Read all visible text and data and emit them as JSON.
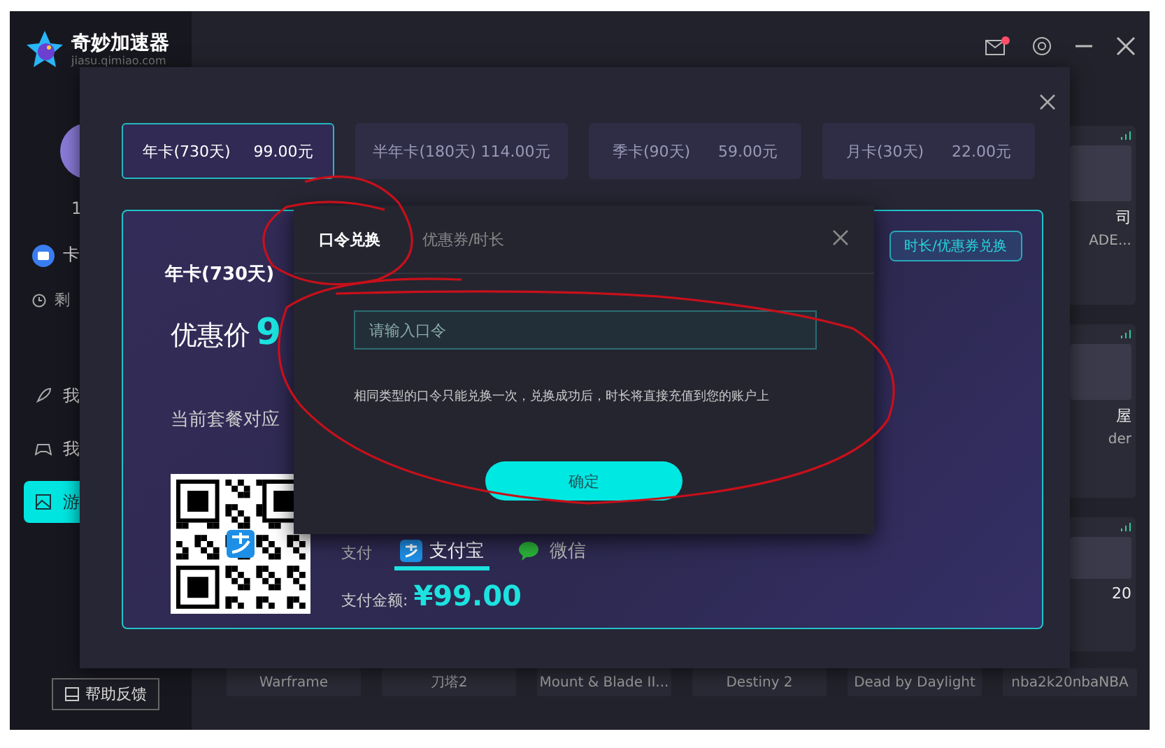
{
  "app": {
    "name": "奇妙加速器",
    "domain": "jiasu.qimiao.com"
  },
  "sidebar": {
    "user_fragment": "1",
    "card_label": "卡",
    "remaining_label": "剩",
    "items": [
      {
        "kind": "rocket",
        "label": "我",
        "selected": false
      },
      {
        "kind": "gamepad",
        "label": "我",
        "selected": false
      },
      {
        "kind": "picture",
        "label": "游",
        "selected": true
      }
    ],
    "help_button": "帮助反馈"
  },
  "games": {
    "cards": [
      {
        "title": "司",
        "subtitle": "ADE..."
      },
      {
        "title": "屋",
        "subtitle": "der"
      },
      {
        "title": "20"
      }
    ],
    "captions": [
      "Warframe",
      "刀塔2",
      "Mount & Blade II...",
      "Destiny 2",
      "Dead by Daylight",
      "nba2k20nbaNBA"
    ]
  },
  "purchase": {
    "plans": [
      {
        "name": "年卡(730天)",
        "price": "99.00元",
        "selected": true
      },
      {
        "name": "半年卡(180天) 114.00元",
        "selected": false
      },
      {
        "name": "季卡(90天)",
        "price": "59.00元",
        "selected": false
      },
      {
        "name": "月卡(30天)",
        "price": "22.00元",
        "selected": false
      }
    ],
    "plan_title": "年卡(730天)",
    "price_label": "优惠价",
    "price_value": "9",
    "plan_note": "当前套餐对应",
    "redeem_button": "时长/优惠券兑换",
    "pay_label": "支付",
    "pay_methods": [
      {
        "kind": "alipay",
        "label": "支付宝",
        "selected": true
      },
      {
        "kind": "wechat",
        "label": "微信",
        "selected": false
      }
    ],
    "amount_label": "支付金额:",
    "amount": "¥99.00"
  },
  "redeem_dialog": {
    "tabs": [
      {
        "label": "口令兑换",
        "selected": true
      },
      {
        "label": "优惠券/时长",
        "selected": false
      }
    ],
    "placeholder": "请输入口令",
    "note": "相同类型的口令只能兑换一次，兑换成功后，时长将直接充值到您的账户上",
    "confirm": "确定"
  }
}
